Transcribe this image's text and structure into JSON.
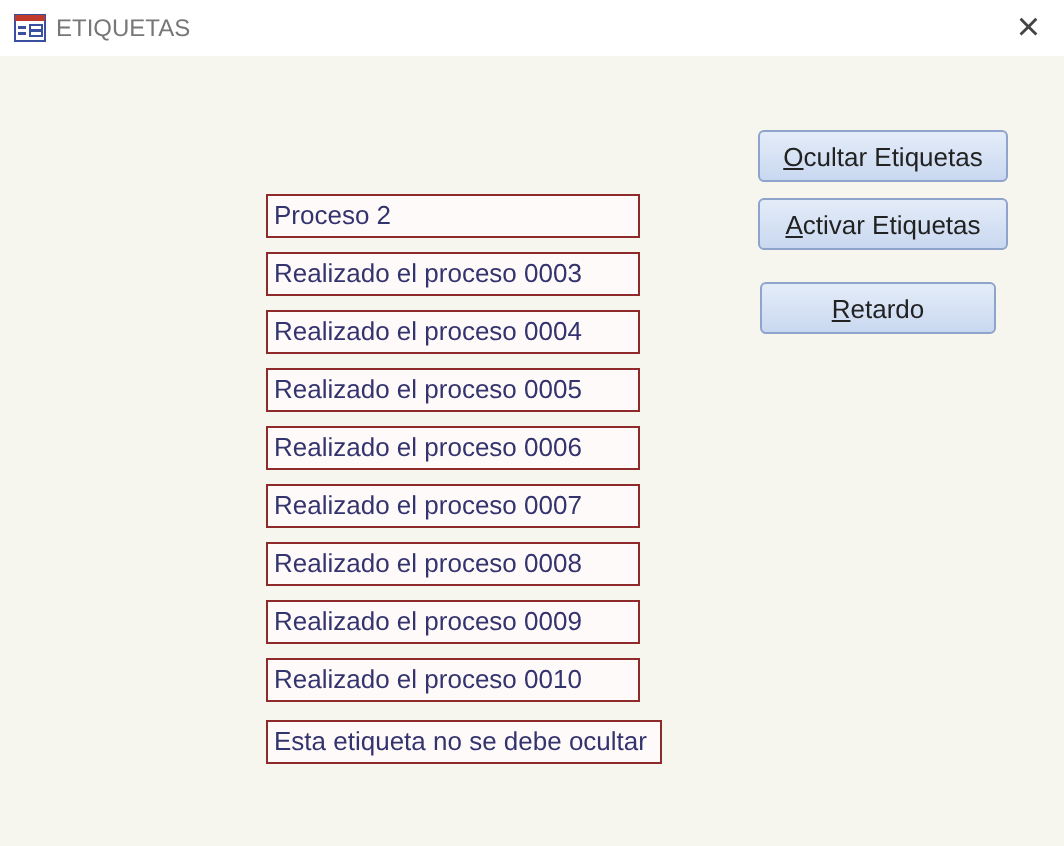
{
  "window": {
    "title": "ETIQUETAS",
    "close": "×"
  },
  "labels": [
    "Proceso 2",
    "Realizado el proceso 0003",
    "Realizado el proceso 0004",
    "Realizado el proceso 0005",
    "Realizado el proceso 0006",
    "Realizado el proceso 0007",
    "Realizado el proceso 0008",
    "Realizado el proceso 0009",
    "Realizado el proceso 0010",
    "Esta etiqueta no se debe ocultar"
  ],
  "buttons": [
    {
      "label": "Ocultar Etiquetas",
      "underline_first": true
    },
    {
      "label": "Activar Etiquetas",
      "underline_first": true
    },
    {
      "label": "Retardo",
      "underline_first": true
    }
  ]
}
